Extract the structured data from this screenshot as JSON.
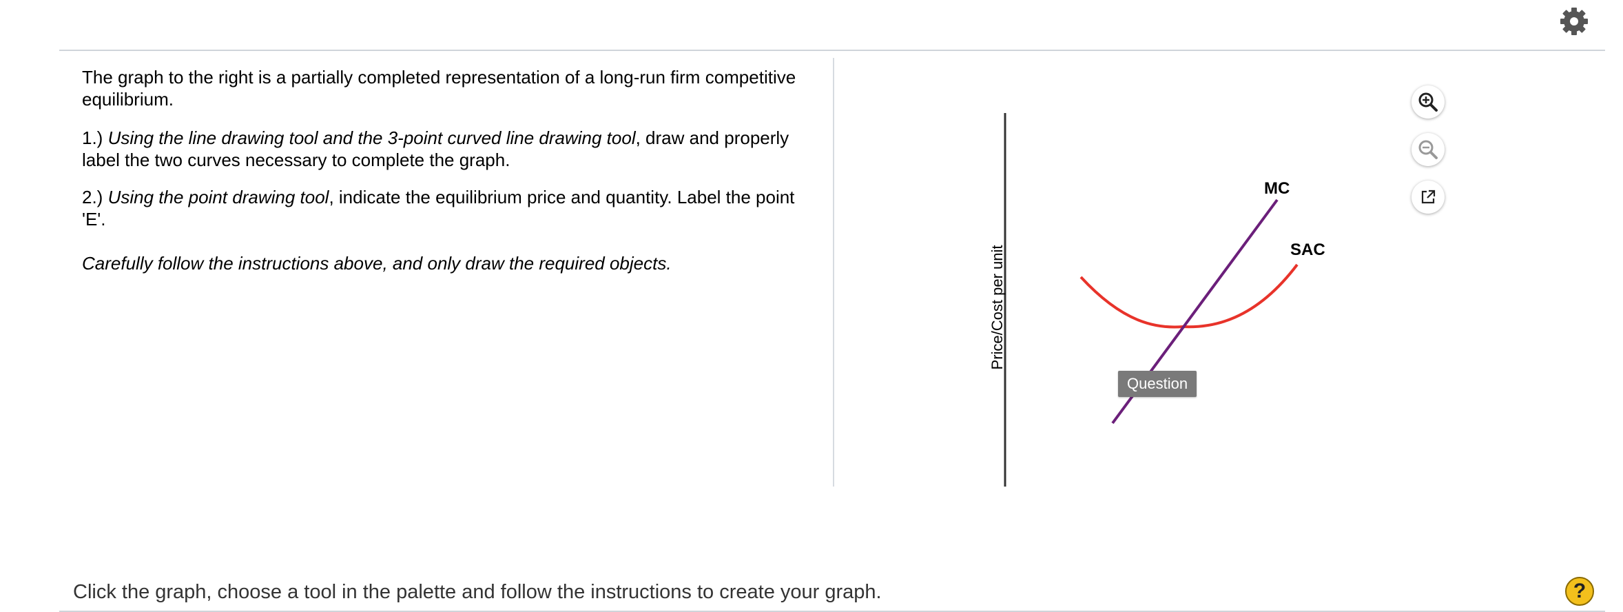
{
  "header": {
    "settings_icon": "gear-icon"
  },
  "question": {
    "intro": "The graph to the right is a partially completed representation of a long-run firm competitive equilibrium.",
    "step1_num": "1.) ",
    "step1_italic": "Using the line drawing tool and the 3-point curved line drawing tool",
    "step1_rest": ", draw and properly label the two curves necessary to complete the graph.",
    "step2_num": "2.) ",
    "step2_italic": "Using the point drawing tool",
    "step2_rest": ", indicate the equilibrium price and quantity. Label the point 'E'.",
    "note": "Carefully follow the instructions above, and only draw the required objects."
  },
  "graph": {
    "y_axis_label": "Price/Cost per unit",
    "mc_label": "MC",
    "sac_label": "SAC",
    "question_tag": "Question",
    "colors": {
      "mc": "#6b1f7a",
      "sac": "#e8332a",
      "axis": "#333333"
    },
    "tools": [
      "zoom-in-icon",
      "zoom-out-icon",
      "pop-out-icon"
    ]
  },
  "footer": {
    "instruction": "Click the graph, choose a tool in the palette and follow the instructions to create your graph.",
    "help_label": "?"
  }
}
